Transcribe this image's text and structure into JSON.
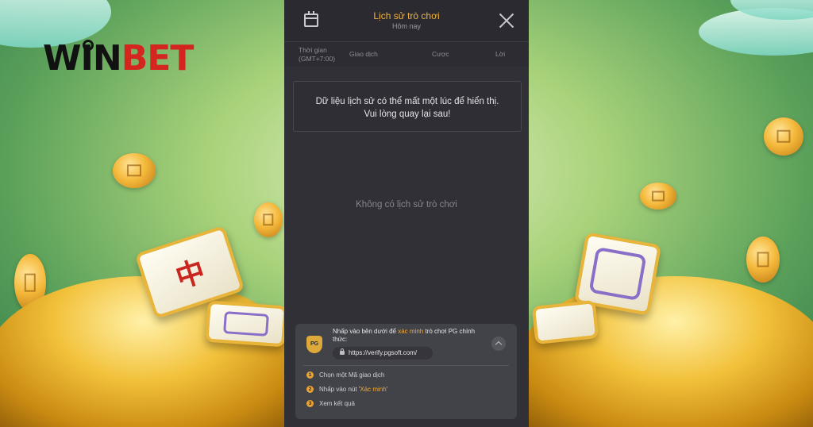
{
  "brand": {
    "logo_w": "WIN",
    "logo_b": "BET"
  },
  "header": {
    "title": "Lịch sử trò chơi",
    "subtitle": "Hôm nay"
  },
  "columns": {
    "time_line1": "Thời gian",
    "time_line2": "(GMT+7:00)",
    "transaction": "Giao dịch",
    "bet": "Cược",
    "win": "Lời"
  },
  "notice": {
    "line1": "Dữ liệu lịch sử có thể mất một lúc để hiển thị.",
    "line2": "Vui lòng quay lại sau!"
  },
  "empty_text": "Không có lịch sử trò chơi",
  "verify": {
    "badge": "PG",
    "text_before": "Nhấp vào bên dưới để ",
    "text_highlight": "xác minh",
    "text_after": " trò chơi PG chính thức:",
    "url": "https://verify.pgsoft.com/",
    "steps": [
      {
        "num": "1",
        "before": "Chọn một Mã giao dịch",
        "highlight": "",
        "after": ""
      },
      {
        "num": "2",
        "before": "Nhấp vào nút '",
        "highlight": "Xác minh",
        "after": "'"
      },
      {
        "num": "3",
        "before": "Xem kết quả",
        "highlight": "",
        "after": ""
      }
    ]
  },
  "colors": {
    "accent": "#f3b43d",
    "panel": "#303036"
  }
}
